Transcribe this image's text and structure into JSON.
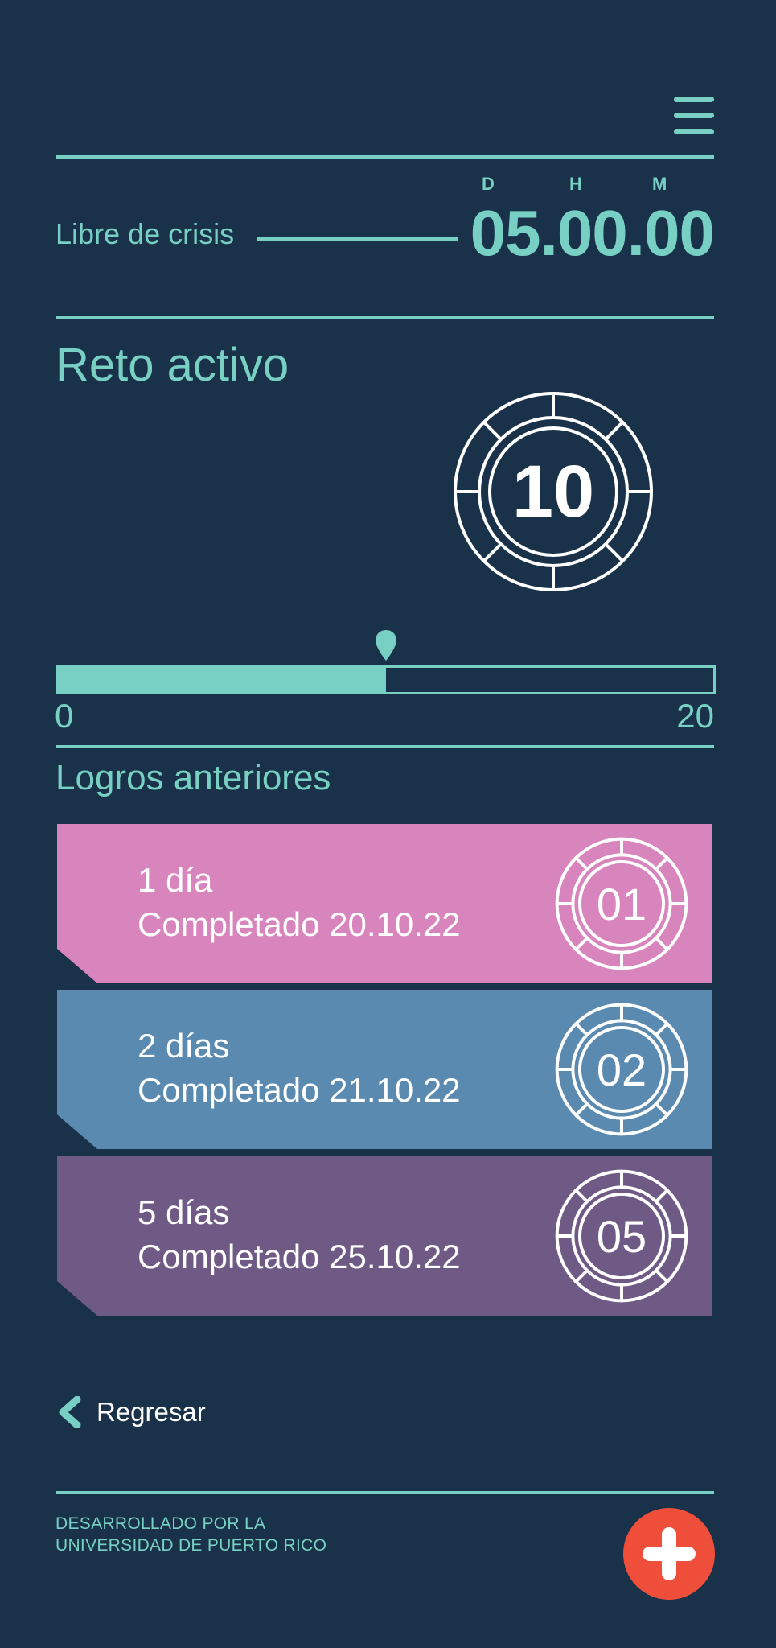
{
  "header": {
    "menu_icon": "menu-icon",
    "dhm_labels": [
      "D",
      "H",
      "M"
    ],
    "libre_label": "Libre de crisis",
    "timer": "05.00.00"
  },
  "reto": {
    "title": "Reto activo",
    "badge_number": "10",
    "progress": {
      "min_label": "0",
      "max_label": "20",
      "current": 10,
      "max": 20
    }
  },
  "logros": {
    "title": "Logros anteriores",
    "cards": [
      {
        "line1": "1 día",
        "line2": "Completado 20.10.22",
        "badge": "01",
        "color": "#d985bd"
      },
      {
        "line1": "2 días",
        "line2": "Completado 21.10.22",
        "badge": "02",
        "color": "#5b8ab1"
      },
      {
        "line1": "5 días",
        "line2": "Completado 25.10.22",
        "badge": "05",
        "color": "#6f5a86"
      }
    ]
  },
  "nav": {
    "back_label": "Regresar",
    "back_icon": "chevron-left-icon"
  },
  "footer": {
    "line1": "DESARROLLADO POR LA",
    "line2": "UNIVERSIDAD DE PUERTO RICO",
    "fab_icon": "plus-icon",
    "fab_color": "#ef4e3a"
  },
  "colors": {
    "background": "#1a3249",
    "accent": "#77d0c3"
  }
}
